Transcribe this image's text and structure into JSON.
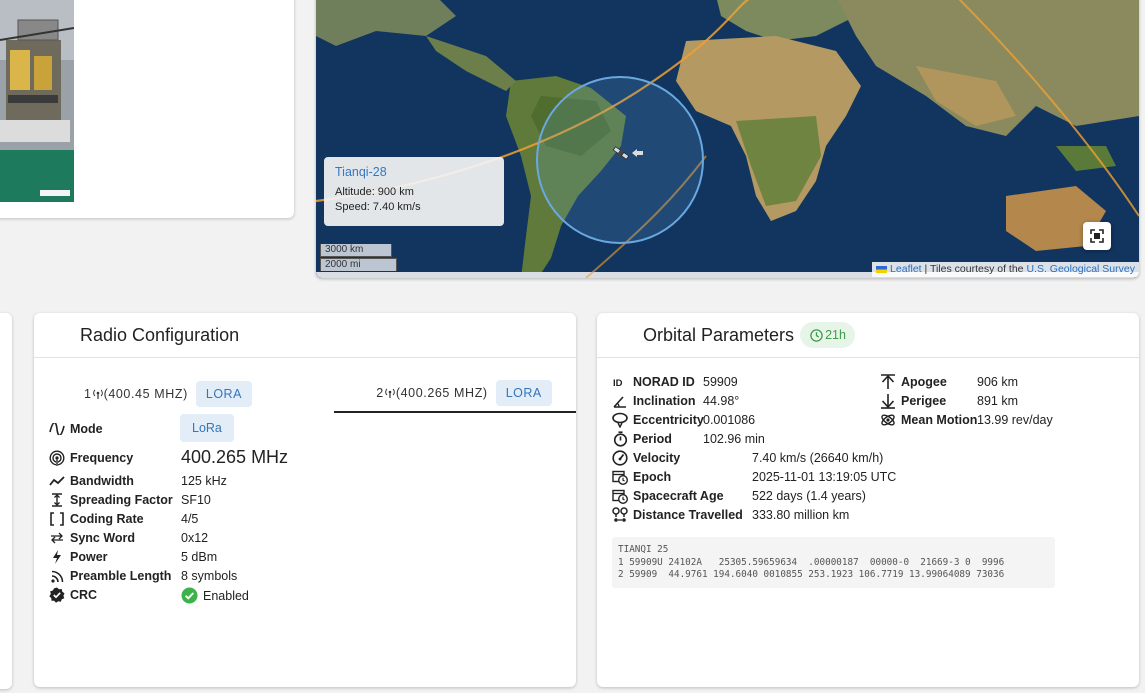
{
  "map": {
    "satellite_name": "Tianqi-28",
    "altitude_text": "Altitude: 900 km",
    "speed_text": "Speed: 7.40 km/s",
    "scale_km": "3000 km",
    "scale_mi": "2000 mi",
    "attribution_link": "Leaflet",
    "attribution_text": " | Tiles courtesy of the ",
    "attribution_source": "U.S. Geological Survey"
  },
  "radio": {
    "title": "Radio Configuration",
    "tabs": [
      {
        "label": "1 (400.45 MHZ)",
        "num": "1",
        "freq": "(400.45 MHZ)",
        "badge": "LORA"
      },
      {
        "label": "2 (400.265 MHZ)",
        "num": "2",
        "freq": "(400.265 MHZ)",
        "badge": "LORA"
      }
    ],
    "mode_label": "Mode",
    "mode_value": "LoRa",
    "frequency_label": "Frequency",
    "frequency_value": "400.265 MHz",
    "rows": [
      {
        "label": "Bandwidth",
        "value": "125 kHz"
      },
      {
        "label": "Spreading Factor",
        "value": "SF10"
      },
      {
        "label": "Coding Rate",
        "value": "4/5"
      },
      {
        "label": "Sync Word",
        "value": "0x12"
      },
      {
        "label": "Power",
        "value": "5 dBm"
      },
      {
        "label": "Preamble Length",
        "value": "8 symbols"
      }
    ],
    "crc_label": "CRC",
    "crc_value": "Enabled"
  },
  "orbit": {
    "title": "Orbital Parameters",
    "age_badge": "21h",
    "left": [
      {
        "label": "NORAD ID",
        "value": "59909"
      },
      {
        "label": "Inclination",
        "value": "44.98°"
      },
      {
        "label": "Eccentricity",
        "value": "0.001086"
      },
      {
        "label": "Period",
        "value": "102.96 min"
      }
    ],
    "right": [
      {
        "label": "Apogee",
        "value": "906 km"
      },
      {
        "label": "Perigee",
        "value": "891 km"
      },
      {
        "label": "Mean Motion",
        "value": "13.99 rev/day"
      }
    ],
    "wide": [
      {
        "label": "Velocity",
        "value": "7.40 km/s (26640 km/h)"
      },
      {
        "label": "Epoch",
        "value": "2025-11-01 13:19:05 UTC"
      },
      {
        "label": "Spacecraft Age",
        "value": "522 days (1.4 years)"
      },
      {
        "label": "Distance Travelled",
        "value": "333.80 million km"
      }
    ],
    "tle": "TIANQI 25\n1 59909U 24102A   25305.59659634  .00000187  00000-0  21669-3 0  9996\n2 59909  44.9761 194.6040 0010855 253.1923 106.7719 13.99064089 73036"
  },
  "colors": {
    "accent_blue": "#3575b8",
    "badge_green": "#3f9a4a",
    "orbit_line": "#f0a030",
    "footprint": "#6aa8e0"
  }
}
